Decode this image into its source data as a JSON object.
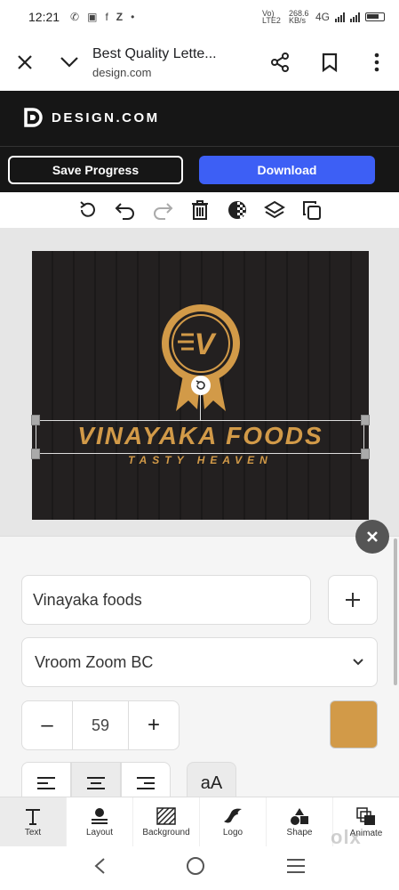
{
  "status_bar": {
    "time": "12:21",
    "network_rate": "268.6 KB/s",
    "network_type": "4G",
    "volte": "Vo) LTE2"
  },
  "browser": {
    "page_title": "Best Quality Lette...",
    "domain": "design.com"
  },
  "site": {
    "logo_text": "DESIGN.COM",
    "save_label": "Save Progress",
    "download_label": "Download"
  },
  "design": {
    "brand_name": "VINAYAKA FOODS",
    "tagline": "TASTY HEAVEN",
    "badge_letter": "V",
    "brand_color": "#d29a48",
    "background_color": "#232020"
  },
  "editor": {
    "text_value": "Vinayaka foods",
    "font_name": "Vroom Zoom BC",
    "font_size": "59",
    "decrease_label": "–",
    "increase_label": "+",
    "case_label": "aA",
    "text_color": "#d29a48"
  },
  "tabs": [
    {
      "label": "Text"
    },
    {
      "label": "Layout"
    },
    {
      "label": "Background"
    },
    {
      "label": "Logo"
    },
    {
      "label": "Shape"
    },
    {
      "label": "Animate"
    }
  ],
  "watermark": "olx"
}
